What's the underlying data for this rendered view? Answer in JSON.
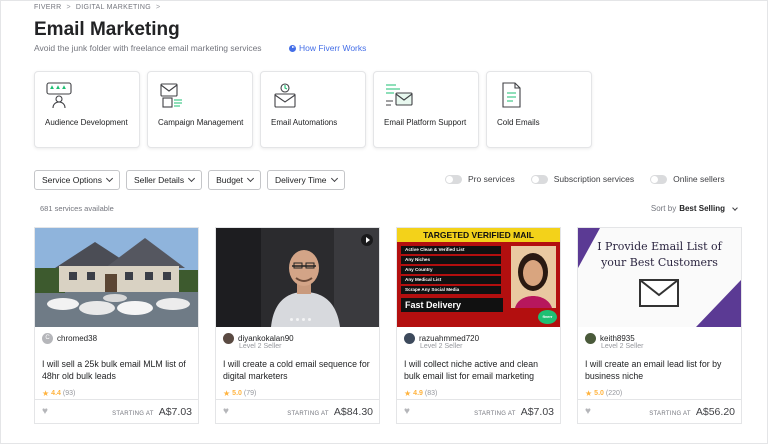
{
  "breadcrumb": {
    "items": [
      "FIVERR",
      "DIGITAL MARKETING"
    ],
    "sep": ">"
  },
  "page": {
    "title": "Email Marketing",
    "subtitle": "Avoid the junk folder with freelance email marketing services",
    "how_link": "How Fiverr Works"
  },
  "categories": [
    {
      "label": "Audience Development",
      "icon": "audience-icon"
    },
    {
      "label": "Campaign Management",
      "icon": "campaign-icon"
    },
    {
      "label": "Email Automations",
      "icon": "automation-icon"
    },
    {
      "label": "Email Platform Support",
      "icon": "platform-icon"
    },
    {
      "label": "Cold Emails",
      "icon": "cold-email-icon"
    }
  ],
  "filters": [
    "Service Options",
    "Seller Details",
    "Budget",
    "Delivery Time"
  ],
  "toggles": [
    "Pro services",
    "Subscription services",
    "Online sellers"
  ],
  "results": {
    "count_text": "681 services available",
    "sort_label": "Sort by",
    "sort_value": "Best Selling"
  },
  "gigs": [
    {
      "seller": "chromed38",
      "avatar_letter": "C",
      "level": "",
      "title": "I will sell a 25k bulk email MLM list of 48hr old bulk leads",
      "rating": "4.4",
      "reviews": "(93)",
      "starting": "STARTING AT",
      "price": "A$7.03"
    },
    {
      "seller": "diyankokalan90",
      "avatar_letter": "",
      "level": "Level 2 Seller",
      "title": "I will create a cold email sequence for digital marketers",
      "rating": "5.0",
      "reviews": "(79)",
      "starting": "STARTING AT",
      "price": "A$84.30"
    },
    {
      "seller": "razuahmmed720",
      "avatar_letter": "",
      "level": "Level 2 Seller",
      "title": "I will collect niche active and clean bulk email list for email marketing",
      "rating": "4.9",
      "reviews": "(83)",
      "starting": "STARTING AT",
      "price": "A$7.03",
      "banner": {
        "heading": "TARGETED VERIFIED MAIL",
        "items": [
          "Active Clean & Verified List",
          "Any Niches",
          "Any Country",
          "Any Medical List",
          "Scrape Any Social Media"
        ],
        "footer": "Fast Delivery",
        "badge": "fiverr"
      }
    },
    {
      "seller": "keith8935",
      "avatar_letter": "",
      "level": "Level 2 Seller",
      "title": "I will create an email lead list for by business niche",
      "rating": "5.0",
      "reviews": "(220)",
      "starting": "STARTING AT",
      "price": "A$56.20",
      "banner": {
        "line1": "I Provide Email List of",
        "line2": "your Best Customers"
      }
    }
  ],
  "colors": {
    "link": "#446ee7",
    "star": "#ffb33e",
    "text": "#222325",
    "muted": "#74767e"
  }
}
